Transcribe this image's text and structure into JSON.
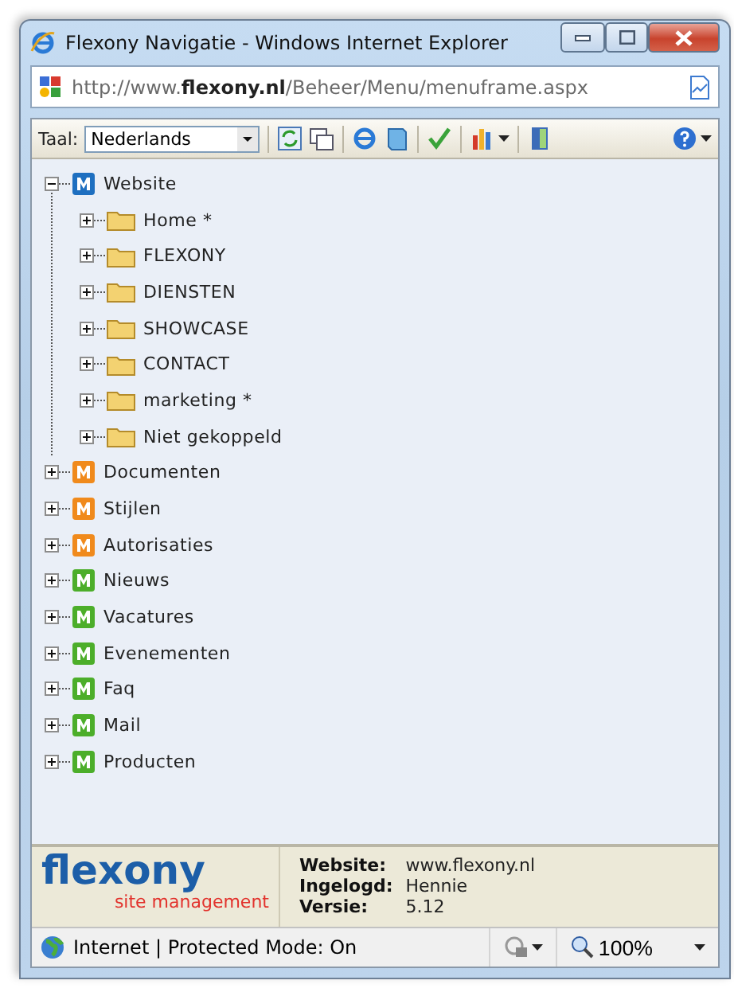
{
  "window": {
    "title": "Flexony Navigatie - Windows Internet Explorer"
  },
  "address_bar": {
    "url": "http://www.**flexony.nl**/Beheer/Menu/menuframe.aspx"
  },
  "toolbar": {
    "language_label": "Taal:",
    "language_value": "Nederlands"
  },
  "tree": [
    {
      "label": "Website",
      "color": "#1e6fc0",
      "expanded": true,
      "children": [
        {
          "label": "Home *",
          "expanded": false
        },
        {
          "label": "FLEXONY",
          "expanded": false
        },
        {
          "label": "DIENSTEN",
          "expanded": false
        },
        {
          "label": "SHOWCASE",
          "expanded": false
        },
        {
          "label": "CONTACT",
          "expanded": false
        },
        {
          "label": "marketing *",
          "expanded": false
        },
        {
          "label": "Niet gekoppeld",
          "expanded": false
        }
      ]
    },
    {
      "label": "Documenten",
      "color": "#f08a1c",
      "expanded": false
    },
    {
      "label": "Stijlen",
      "color": "#f08a1c",
      "expanded": false
    },
    {
      "label": "Autorisaties",
      "color": "#f08a1c",
      "expanded": false
    },
    {
      "label": "Nieuws",
      "color": "#4cae2a",
      "expanded": false
    },
    {
      "label": "Vacatures",
      "color": "#4cae2a",
      "expanded": false
    },
    {
      "label": "Evenementen",
      "color": "#4cae2a",
      "expanded": false
    },
    {
      "label": "Faq",
      "color": "#4cae2a",
      "expanded": false
    },
    {
      "label": "Mail",
      "color": "#4cae2a",
      "expanded": false
    },
    {
      "label": "Producten",
      "color": "#4cae2a",
      "expanded": false
    }
  ],
  "footer": {
    "logo": "flexony",
    "tagline": "site management",
    "info": [
      {
        "label": "Website:",
        "value": "www.flexony.nl"
      },
      {
        "label": "Ingelogd:",
        "value": "Hennie"
      },
      {
        "label": "Versie:",
        "value": "5.12"
      }
    ]
  },
  "status_bar": {
    "zone": "Internet | Protected Mode: On",
    "zoom": "100%"
  }
}
